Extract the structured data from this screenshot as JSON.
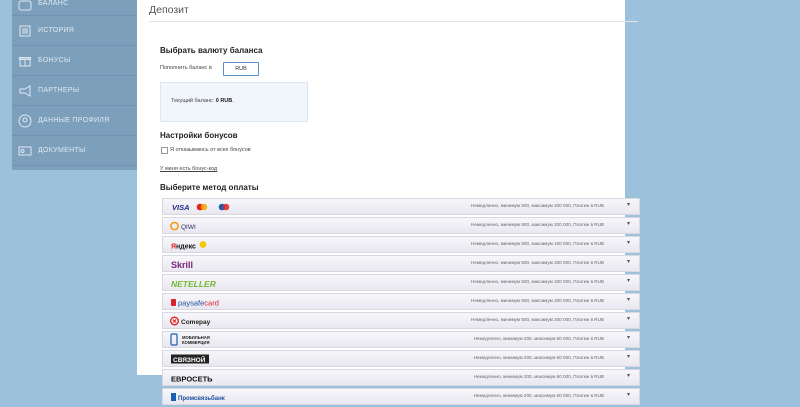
{
  "sidebar": {
    "items": [
      {
        "label": "БАЛАНС",
        "icon": "wallet-icon"
      },
      {
        "label": "ИСТОРИЯ",
        "icon": "history-icon"
      },
      {
        "label": "БОНУСЫ",
        "icon": "gift-icon"
      },
      {
        "label": "ПАРТНЕРЫ",
        "icon": "megaphone-icon"
      },
      {
        "label": "ДАННЫЕ ПРОФИЛЯ",
        "icon": "user-icon"
      },
      {
        "label": "ДОКУМЕНТЫ",
        "icon": "id-card-icon"
      }
    ]
  },
  "main": {
    "title": "Депозит",
    "currency_heading": "Выбрать валюту баланса",
    "topup_label": "Пополнить баланс в",
    "currency_value": "RUB",
    "balance_label": "Текущий баланс:",
    "balance_value": "0 RUB",
    "bonus_heading": "Настройки бонусов",
    "bonus_refuse_label": "Я отказываюсь от всех бонусов",
    "promo_link": "У меня есть бонус-код",
    "methods_heading": "Выберите метод оплаты"
  },
  "methods": [
    {
      "name": "VISA / MasterCard / Maestro",
      "info": "Немедленно, минимум 500, максимум 200 000, Платеж в RUB"
    },
    {
      "name": "QIWI",
      "info": "Немедленно, минимум 500, максимум 200 000, Платеж в RUB"
    },
    {
      "name": "Яндекс",
      "info": "Немедленно, минимум 500, максимум 100 000, Платеж в RUB"
    },
    {
      "name": "Skrill",
      "info": "Немедленно, минимум 500, максимум 200 000, Платеж в RUB"
    },
    {
      "name": "NETELLER",
      "info": "Немедленно, минимум 500, максимум 200 000, Платеж в RUB"
    },
    {
      "name": "paysafecard",
      "info": "Немедленно, минимум 500, максимум 200 000, Платеж в RUB"
    },
    {
      "name": "Comepay",
      "info": "Немедленно, минимум 500, максимум 200 000, Платеж в RUB"
    },
    {
      "name": "МОБИЛЬНАЯ КОММЕРЦИЯ",
      "info": "Немедленно, минимум 200, максимум 60 000, Платеж в RUB"
    },
    {
      "name": "СВЯЗНОЙ",
      "info": "Немедленно, минимум 200, максимум 60 000, Платеж в RUB"
    },
    {
      "name": "ЕВРОСЕТЬ",
      "info": "Немедленно, минимум 200, максимум 60 000, Платеж в RUB"
    },
    {
      "name": "Промсвязьбанк",
      "info": "Немедленно, минимум 200, максимум 60 000, Платеж в RUB"
    }
  ]
}
